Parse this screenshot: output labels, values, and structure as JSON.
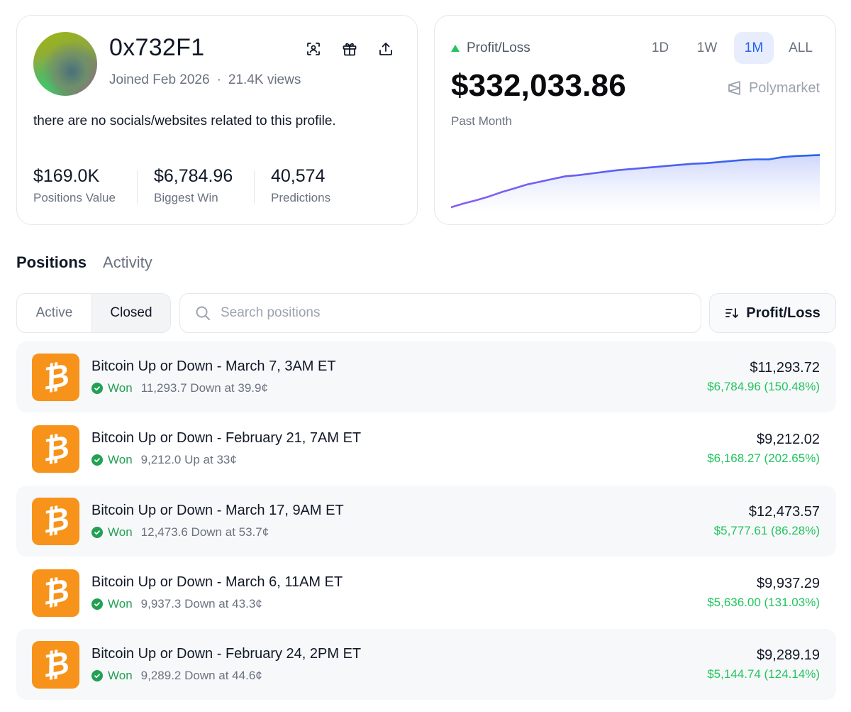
{
  "profile": {
    "username": "0x732F1",
    "joined": "Joined Feb 2026",
    "views": "21.4K views",
    "bio": "there are no socials/websites related to this profile.",
    "stats": [
      {
        "value": "$169.0K",
        "label": "Positions Value"
      },
      {
        "value": "$6,784.96",
        "label": "Biggest Win"
      },
      {
        "value": "40,574",
        "label": "Predictions"
      }
    ],
    "icons": [
      "scan-icon",
      "gift-icon",
      "share-icon"
    ],
    "avatar_colors": [
      "#9db80f",
      "#3fcf6a",
      "#4a6f7a",
      "#b05a8a"
    ]
  },
  "pnl": {
    "label": "Profit/Loss",
    "value": "$332,033.86",
    "period": "Past Month",
    "brand": "Polymarket",
    "ranges": [
      "1D",
      "1W",
      "1M",
      "ALL"
    ],
    "active_range": "1M",
    "accent": "#2563eb",
    "up_color": "#22c55e"
  },
  "tabs": {
    "items": [
      "Positions",
      "Activity"
    ],
    "active": "Positions"
  },
  "filters": {
    "segments": [
      "Active",
      "Closed"
    ],
    "active_segment": "Closed",
    "search_placeholder": "Search positions",
    "sort_label": "Profit/Loss"
  },
  "positions": [
    {
      "title": "Bitcoin Up or Down - March 7, 3AM ET",
      "status": "Won",
      "detail": "11,293.7 Down at 39.9¢",
      "amount": "$11,293.72",
      "gain": "$6,784.96 (150.48%)"
    },
    {
      "title": "Bitcoin Up or Down - February 21, 7AM ET",
      "status": "Won",
      "detail": "9,212.0 Up at 33¢",
      "amount": "$9,212.02",
      "gain": "$6,168.27 (202.65%)"
    },
    {
      "title": "Bitcoin Up or Down - March 17, 9AM ET",
      "status": "Won",
      "detail": "12,473.6 Down at 53.7¢",
      "amount": "$12,473.57",
      "gain": "$5,777.61 (86.28%)"
    },
    {
      "title": "Bitcoin Up or Down - March 6, 11AM ET",
      "status": "Won",
      "detail": "9,937.3 Down at 43.3¢",
      "amount": "$9,937.29",
      "gain": "$5,636.00 (131.03%)"
    },
    {
      "title": "Bitcoin Up or Down - February 24, 2PM ET",
      "status": "Won",
      "detail": "9,289.2 Down at 44.6¢",
      "amount": "$9,289.19",
      "gain": "$5,144.74 (124.14%)"
    }
  ],
  "coin_color": "#f7931a",
  "won_color": "#22a054",
  "chart_data": {
    "type": "area",
    "x": [
      0,
      1,
      2,
      3,
      4,
      5,
      6,
      7,
      8,
      9,
      10,
      11,
      12,
      13,
      14,
      15,
      16,
      17,
      18,
      19,
      20,
      21,
      22,
      23,
      24,
      25,
      26,
      27,
      28,
      29
    ],
    "series": [
      {
        "values": [
          0.0,
          0.07,
          0.13,
          0.2,
          0.28,
          0.35,
          0.42,
          0.47,
          0.52,
          0.57,
          0.59,
          0.62,
          0.65,
          0.68,
          0.7,
          0.72,
          0.74,
          0.76,
          0.78,
          0.8,
          0.81,
          0.83,
          0.85,
          0.87,
          0.88,
          0.88,
          0.92,
          0.94,
          0.95,
          0.96
        ]
      }
    ],
    "ylim": [
      0,
      1.2
    ],
    "grid": false,
    "line_colors": [
      "#8b5cf6",
      "#2563eb"
    ]
  }
}
